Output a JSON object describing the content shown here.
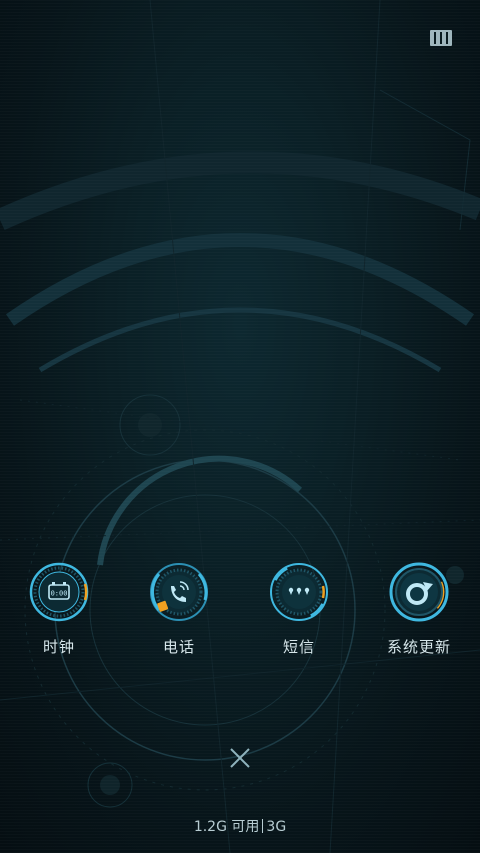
{
  "apps": [
    {
      "label": "时钟",
      "icon": "clock-icon"
    },
    {
      "label": "电话",
      "icon": "phone-icon"
    },
    {
      "label": "短信",
      "icon": "message-icon"
    },
    {
      "label": "系统更新",
      "icon": "system-update-icon"
    }
  ],
  "menu": {
    "icon": "menu-icon"
  },
  "close": {
    "icon": "close-icon"
  },
  "memory": {
    "available": "1.2G 可用",
    "network": "3G"
  },
  "colors": {
    "accent": "#3fb8e0",
    "accent_glow": "#6fd3f2",
    "warning": "#f0a020",
    "text": "#d6e6ea",
    "background": "#071418"
  }
}
